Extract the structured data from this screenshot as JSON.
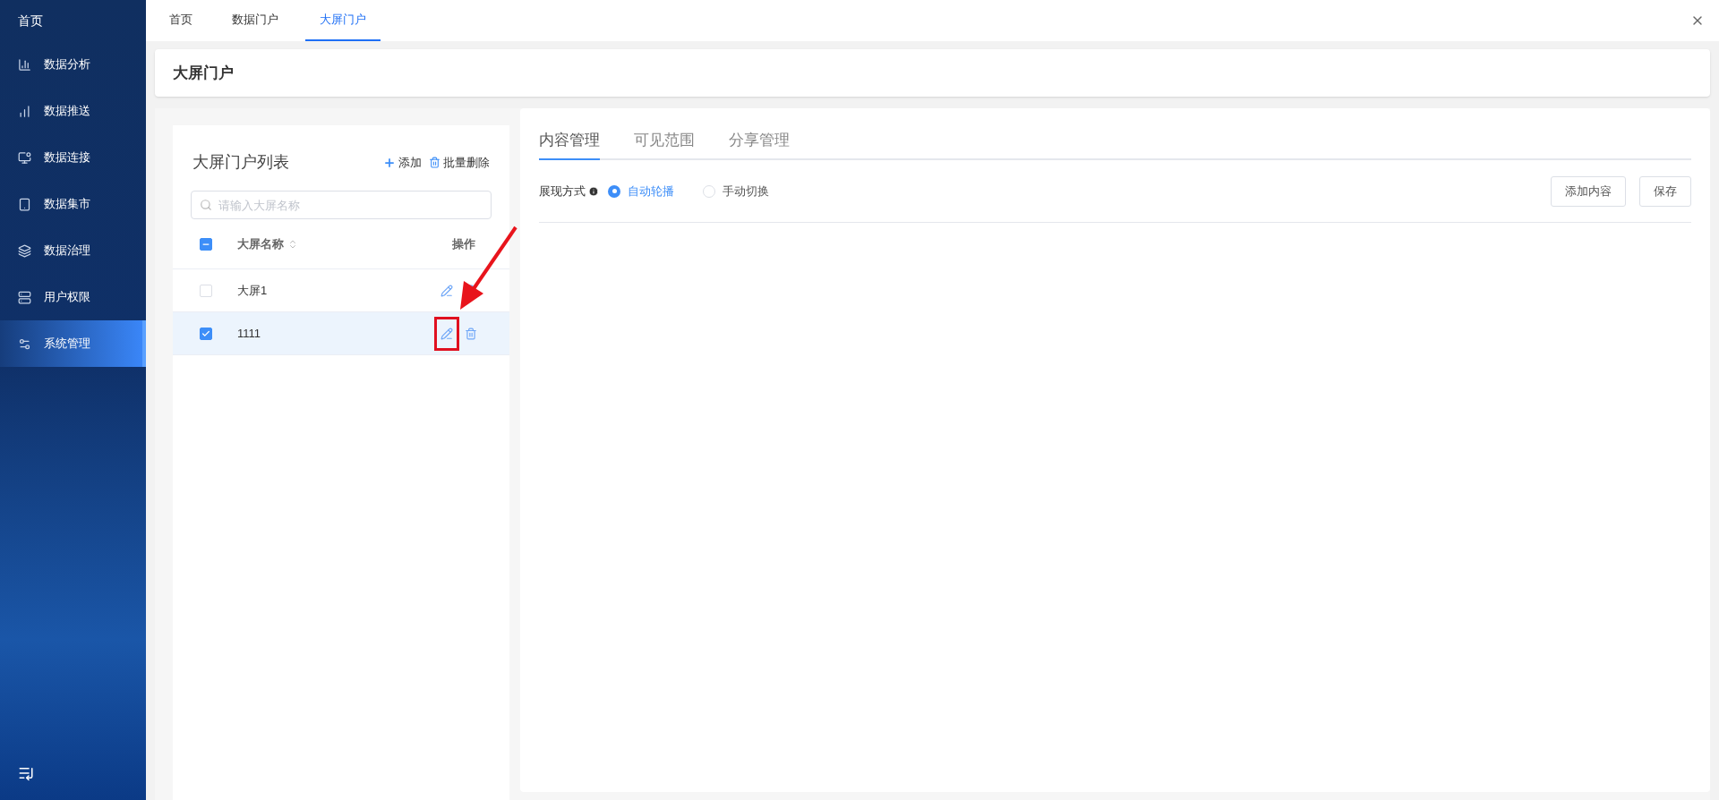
{
  "sidebar": {
    "home": "首页",
    "items": [
      {
        "label": "数据分析",
        "selected": false
      },
      {
        "label": "数据推送",
        "selected": false
      },
      {
        "label": "数据连接",
        "selected": false
      },
      {
        "label": "数据集市",
        "selected": false
      },
      {
        "label": "数据治理",
        "selected": false
      },
      {
        "label": "用户权限",
        "selected": false
      },
      {
        "label": "系统管理",
        "selected": true
      }
    ]
  },
  "tabs": [
    {
      "label": "首页",
      "selected": false
    },
    {
      "label": "数据门户",
      "selected": false
    },
    {
      "label": "大屏门户",
      "selected": true
    }
  ],
  "page_title": "大屏门户",
  "list_panel": {
    "title": "大屏门户列表",
    "actions": [
      "添加",
      "批量删除"
    ],
    "search": {
      "placeholder": "请输入大屏名称"
    },
    "select_all": {
      "checked": true,
      "indeterminate": true
    },
    "columns": [
      "大屏名称",
      "操作"
    ],
    "rows": [
      {
        "name": "大屏1",
        "checked": false,
        "selected": false,
        "highlighted": false
      },
      {
        "name": "1111",
        "checked": true,
        "selected": true,
        "highlighted": true
      }
    ]
  },
  "content_panel": {
    "tabs": [
      {
        "label": "内容管理",
        "selected": true
      },
      {
        "label": "可见范围",
        "selected": false
      },
      {
        "label": "分享管理",
        "selected": false
      }
    ],
    "display_mode": {
      "label": "展现方式",
      "options": [
        {
          "label": "自动轮播",
          "selected": true
        },
        {
          "label": "手动切换",
          "selected": false
        }
      ]
    },
    "buttons": [
      "添加内容",
      "保存"
    ]
  }
}
